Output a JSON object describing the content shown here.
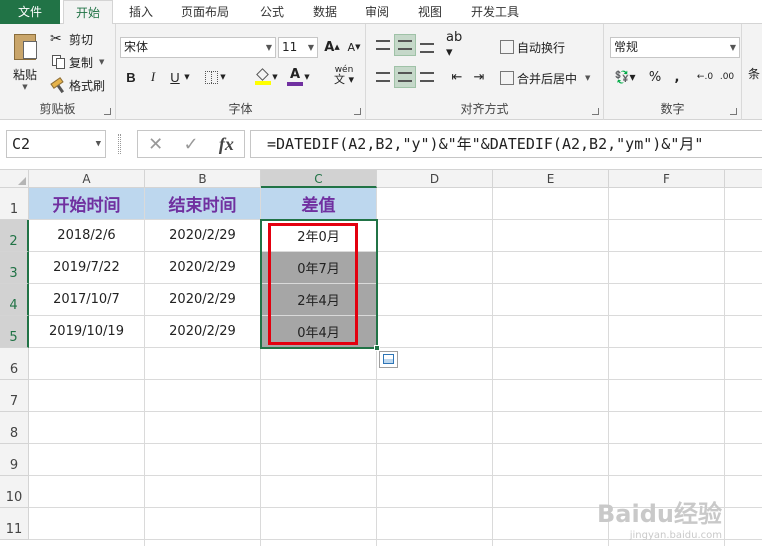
{
  "tabs": [
    "文件",
    "开始",
    "插入",
    "页面布局",
    "公式",
    "数据",
    "审阅",
    "视图",
    "开发工具"
  ],
  "clipboard": {
    "paste": "粘贴",
    "cut": "剪切",
    "copy": "复制",
    "format_painter": "格式刷",
    "label": "剪贴板"
  },
  "font": {
    "name": "宋体",
    "size": "11",
    "bold": "B",
    "italic": "I",
    "underline": "U",
    "label": "字体",
    "grow": "A",
    "shrink": "A",
    "wen": "wén"
  },
  "alignment": {
    "wrap": "自动换行",
    "merge": "合并后居中",
    "label": "对齐方式"
  },
  "number": {
    "format": "常规",
    "percent": "%",
    "comma": ",",
    "label": "数字",
    "cut_label": "条"
  },
  "formula_bar": {
    "cell_ref": "C2",
    "cancel": "✕",
    "enter": "✓",
    "fx": "fx",
    "formula": "=DATEDIF(A2,B2,\"y\")&\"年\"&DATEDIF(A2,B2,\"ym\")&\"月\""
  },
  "columns": [
    "A",
    "B",
    "C",
    "D",
    "E",
    "F"
  ],
  "rows": [
    "1",
    "2",
    "3",
    "4",
    "5",
    "6",
    "7",
    "8",
    "9",
    "10",
    "11"
  ],
  "sheet": {
    "headers": [
      "开始时间",
      "结束时间",
      "差值"
    ],
    "data": [
      [
        "2018/2/6",
        "2020/2/29",
        "2年0月"
      ],
      [
        "2019/7/22",
        "2020/2/29",
        "0年7月"
      ],
      [
        "2017/10/7",
        "2020/2/29",
        "2年4月"
      ],
      [
        "2019/10/19",
        "2020/2/29",
        "0年4月"
      ]
    ]
  },
  "watermark": {
    "brand": "Baidu经验",
    "url": "jingyan.baidu.com"
  },
  "colors": {
    "accent": "#217346",
    "header_fill": "#bdd7ee",
    "header_text": "#7030a0",
    "highlight": "#e3000f"
  }
}
